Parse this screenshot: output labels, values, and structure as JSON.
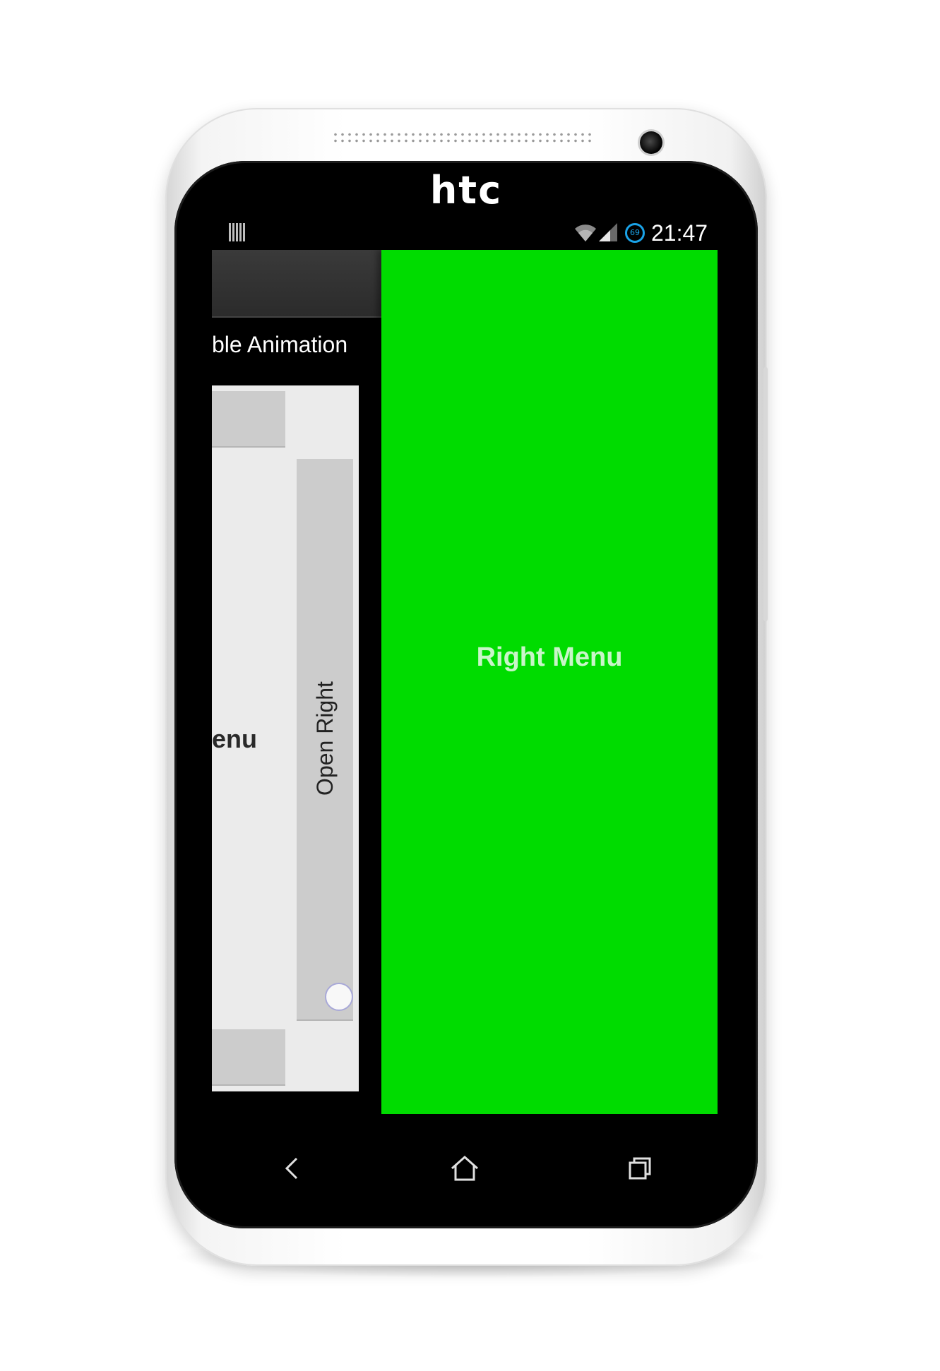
{
  "device": {
    "brand_logo": "htc"
  },
  "status_bar": {
    "time": "21:47",
    "battery_level": "69",
    "icons": [
      "notification-icon",
      "wifi-icon",
      "signal-icon",
      "battery-icon"
    ]
  },
  "main_panel": {
    "subtitle": "ble Animation",
    "open_right_button_label": "Open Right",
    "left_menu_label": "enu"
  },
  "right_menu": {
    "title": "Right Menu",
    "background_color": "#00dc00"
  },
  "nav_bar": {
    "buttons": [
      "back-icon",
      "home-icon",
      "recent-apps-icon"
    ]
  }
}
